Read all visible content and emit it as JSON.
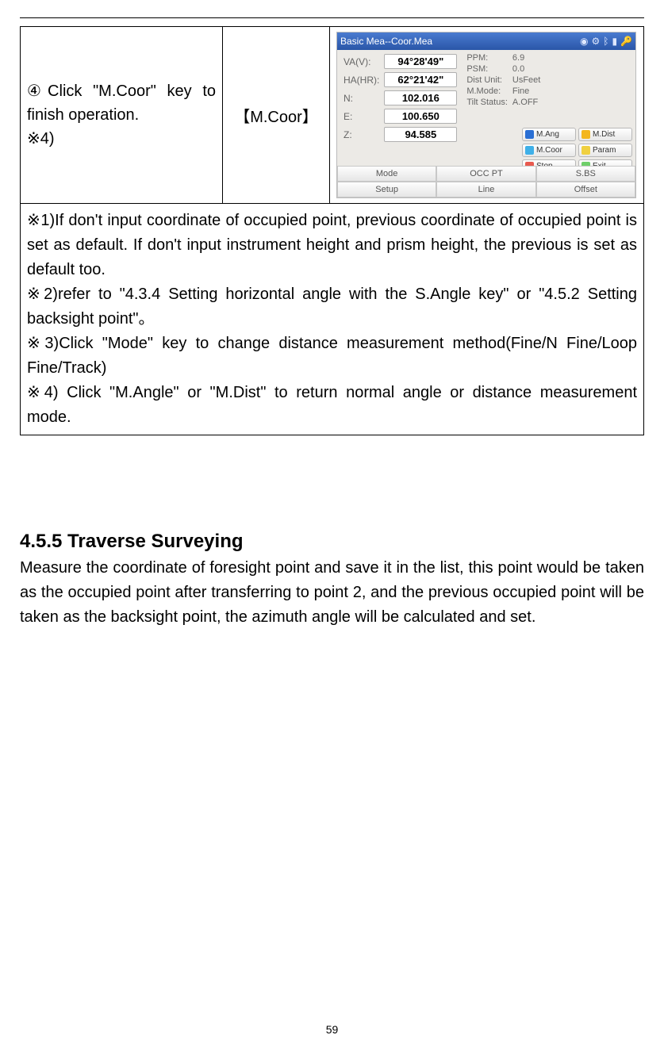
{
  "table_row": {
    "left": "④Click \"M.Coor\" key to finish operation.\n※4)",
    "mid": "【M.Coor】"
  },
  "device": {
    "title": "Basic Mea--Coor.Mea",
    "readings": {
      "va_label": "VA(V):",
      "va_value": "94°28'49\"",
      "ha_label": "HA(HR):",
      "ha_value": "62°21'42\"",
      "n_label": "N:",
      "n_value": "102.016",
      "e_label": "E:",
      "e_value": "100.650",
      "z_label": "Z:",
      "z_value": "94.585"
    },
    "stats": {
      "ppm_label": "PPM:",
      "ppm_value": "6.9",
      "psm_label": "PSM:",
      "psm_value": "0.0",
      "dist_label": "Dist Unit:",
      "dist_value": "UsFeet",
      "mmode_label": "M.Mode:",
      "mmode_value": "Fine",
      "tilt_label": "Tilt Status:",
      "tilt_value": "A.OFF"
    },
    "side_buttons": {
      "mang": "M.Ang",
      "mdist": "M.Dist",
      "mcoor": "M.Coor",
      "param": "Param",
      "stop": "Stop",
      "exit": "Exit"
    },
    "tabs": {
      "mode": "Mode",
      "occpt": "OCC PT",
      "sbs": "S.BS",
      "setup": "Setup",
      "line": "Line",
      "offset": "Offset"
    }
  },
  "notes": {
    "n1": "※1)If don't input coordinate of occupied point, previous coordinate of occupied point is set as default. If don't input instrument height and prism height, the previous is set as default too.",
    "n2": "※2)refer to \"4.3.4 Setting horizontal angle with the S.Angle key\" or \"4.5.2 Setting backsight point\"。",
    "n3": "※3)Click \"Mode\" key to change distance measurement method(Fine/N Fine/Loop Fine/Track)",
    "n4": "※4) Click \"M.Angle\" or \"M.Dist\" to return normal angle or distance measurement mode."
  },
  "section": {
    "heading": "4.5.5 Traverse Surveying",
    "body": "Measure the coordinate of foresight point and save it in the list, this point would be taken as the occupied point after transferring to point 2, and the previous occupied point will be taken as the backsight point, the azimuth angle will be calculated and set."
  },
  "page_number": "59"
}
